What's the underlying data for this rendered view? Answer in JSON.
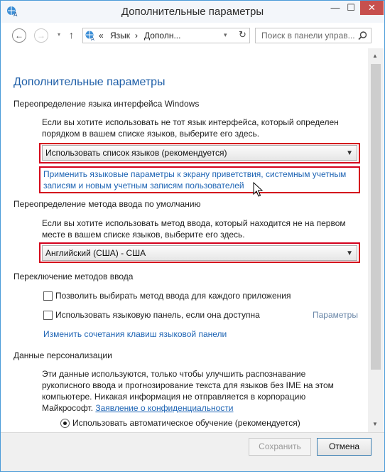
{
  "window": {
    "title": "Дополнительные параметры",
    "controls": {
      "minimize": "—",
      "maximize": "☐",
      "close": "✕"
    }
  },
  "nav": {
    "back": "←",
    "forward": "→",
    "dropdown": "▾",
    "up": "↑",
    "address_segments": [
      "«",
      "Язык",
      "›",
      "Дополн..."
    ],
    "address_chevron": "▾",
    "refresh": "↻",
    "search_placeholder": "Поиск в панели управ..."
  },
  "content": {
    "page_title": "Дополнительные параметры",
    "ui_language": {
      "heading": "Переопределение языка интерфейса Windows",
      "description_line1": "Если вы хотите использовать не тот язык интерфейса, который определен",
      "description_line2": "порядком в вашем списке языков, выберите его здесь.",
      "combo_value": "Использовать список языков (рекомендуется)",
      "link_line1": "Применить языковые параметры к экрану приветствия, системным учетным",
      "link_line2": "записям и новым учетным записям пользователей"
    },
    "input_method": {
      "heading": "Переопределение метода ввода по умолчанию",
      "description_line1": "Если вы хотите использовать метод ввода, который находится не на первом",
      "description_line2": "месте в вашем списке языков, выберите его здесь.",
      "combo_value": "Английский (США) - США"
    },
    "switching": {
      "heading": "Переключение методов ввода",
      "checkbox1_label": "Позволить выбирать метод ввода для каждого приложения",
      "checkbox1_checked": false,
      "checkbox2_label": "Использовать языковую панель, если она доступна",
      "checkbox2_checked": false,
      "options_link": "Параметры",
      "hotkeys_link": "Изменить сочетания клавиш языковой панели"
    },
    "personalization": {
      "heading": "Данные персонализации",
      "description_line1": "Эти данные используются, только чтобы улучшить распознавание",
      "description_line2": "рукописного ввода и прогнозирование текста для языков без IME на этом",
      "description_line3": "компьютере. Никакая информация не отправляется в корпорацию",
      "description_line4_prefix": "Майкрософт.",
      "privacy_link": "Заявление о конфиденциальности",
      "radio_auto_label": "Использовать автоматическое обучение (рекомендуется)",
      "radio_auto_selected": true
    }
  },
  "footer": {
    "save_label": "Сохранить",
    "save_enabled": false,
    "cancel_label": "Отмена"
  },
  "colors": {
    "title_blue": "#1f5fa8",
    "link_blue": "#1e64b4",
    "highlight_red": "#d4001c",
    "window_border": "#4a9bd8",
    "close_red": "#c7504d"
  }
}
